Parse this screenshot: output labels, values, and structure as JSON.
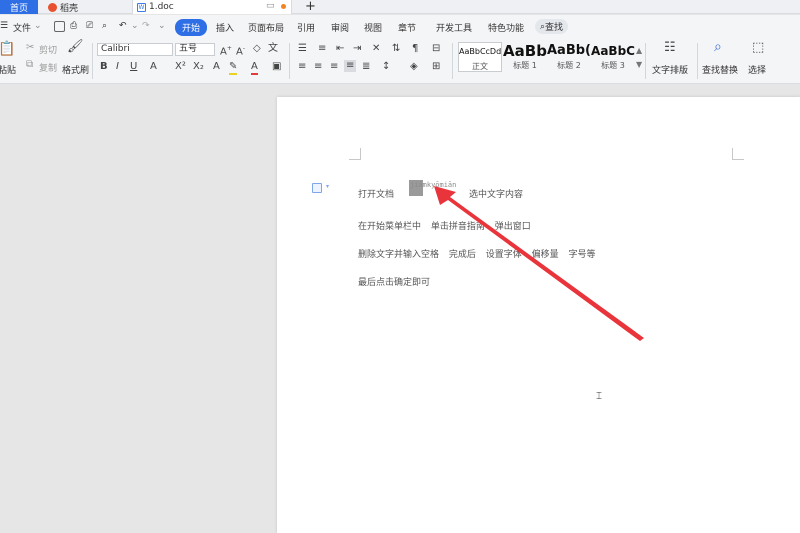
{
  "tabs": {
    "home": "首页",
    "app": "稻壳",
    "doc": "1.doc",
    "doc_icon": "W"
  },
  "menu": {
    "file": "文件",
    "items": [
      "开始",
      "插入",
      "页面布局",
      "引用",
      "审阅",
      "视图",
      "章节",
      "开发工具",
      "特色功能"
    ],
    "search": "查找"
  },
  "ribbon": {
    "cut": "剪切",
    "paste": "粘贴",
    "copy": "复制",
    "format_painter": "格式刷",
    "font_name": "Calibri",
    "font_size": "五号",
    "styles": [
      {
        "sample": "AaBbCcDd",
        "name": "正文"
      },
      {
        "sample": "AaBb",
        "name": "标题 1"
      },
      {
        "sample": "AaBb(",
        "name": "标题 2"
      },
      {
        "sample": "AaBbC",
        "name": "标题 3"
      }
    ],
    "text_layout": "文字排版",
    "find_replace": "查找替换",
    "select": "选择"
  },
  "document": {
    "line1_a": "打开文档",
    "pinyin": "jiāmkyōmiān",
    "line1_b": "选中文字内容",
    "line2": "在开始菜单栏中 单击拼音指南 弹出窗口",
    "line3": "删除文字并输入空格 完成后 设置字体 偏移量 字号等",
    "line4": "最后点击确定即可"
  },
  "annotation": {
    "arrow_color": "#e8343a"
  },
  "colors": {
    "accent": "#2f6fe5",
    "ribbon_bg": "#f4f5f7",
    "workspace_bg": "#e6e6e6"
  }
}
